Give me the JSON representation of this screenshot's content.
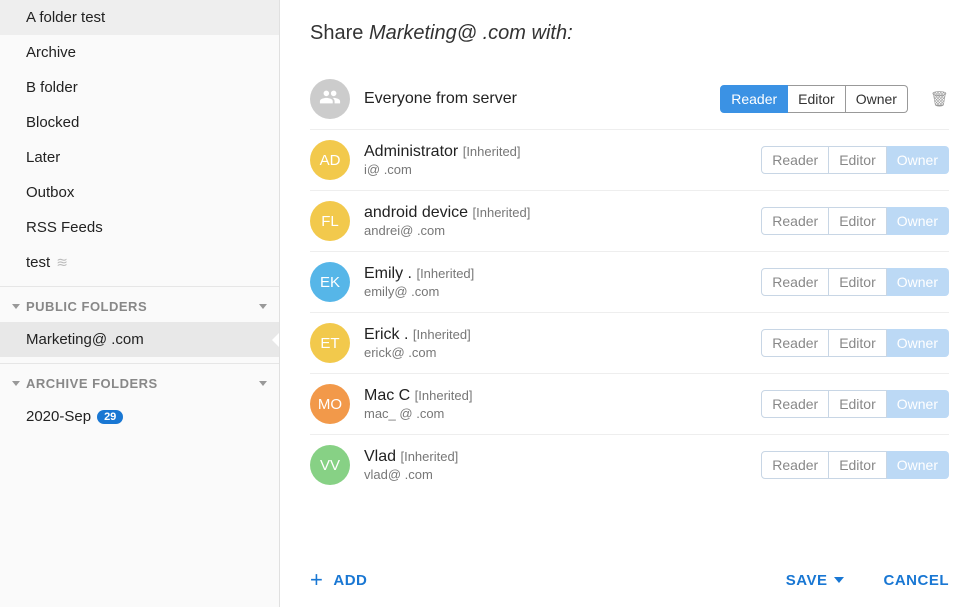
{
  "sidebar": {
    "topItems": [
      {
        "label": "A folder test"
      },
      {
        "label": "Archive"
      },
      {
        "label": "B folder"
      },
      {
        "label": "Blocked"
      },
      {
        "label": "Later"
      },
      {
        "label": "Outbox"
      },
      {
        "label": "RSS Feeds"
      },
      {
        "label": "test",
        "rss": true
      }
    ],
    "publicHeader": "PUBLIC FOLDERS",
    "publicItems": [
      {
        "label": "Marketing@            .com",
        "selected": true
      }
    ],
    "archiveHeader": "ARCHIVE FOLDERS",
    "archiveItems": [
      {
        "label": "2020-Sep",
        "badge": "29"
      }
    ]
  },
  "share": {
    "prefix": "Share ",
    "name": "Marketing@",
    "suffix": "            .com with:",
    "roles": {
      "reader": "Reader",
      "editor": "Editor",
      "owner": "Owner"
    },
    "rows": [
      {
        "avatar": "group",
        "avClass": "av-gray",
        "name": "Everyone from server",
        "email": "",
        "inherited": false,
        "active": "reader",
        "style": "solid",
        "deletable": true
      },
      {
        "avatar": "AD",
        "avClass": "av-yellow",
        "name": "Administrator",
        "email": "        i@             .com",
        "inherited": true,
        "active": "owner",
        "style": "light"
      },
      {
        "avatar": "FL",
        "avClass": "av-yellow",
        "name": "android device",
        "email": "andrei@              .com",
        "inherited": true,
        "active": "owner",
        "style": "light"
      },
      {
        "avatar": "EK",
        "avClass": "av-blue",
        "name": "Emily .",
        "email": "emily@               .com",
        "inherited": true,
        "active": "owner",
        "style": "light"
      },
      {
        "avatar": "ET",
        "avClass": "av-yellow",
        "name": "Erick .",
        "email": "erick@             .com",
        "inherited": true,
        "active": "owner",
        "style": "light"
      },
      {
        "avatar": "MO",
        "avClass": "av-orange",
        "name": "Mac C",
        "email": "mac_        @            .com",
        "inherited": true,
        "active": "owner",
        "style": "light"
      },
      {
        "avatar": "VV",
        "avClass": "av-green",
        "name": "Vlad",
        "email": "vlad@           .com",
        "inherited": true,
        "active": "owner",
        "style": "light"
      }
    ],
    "inheritedTag": "[Inherited]",
    "addLabel": "ADD",
    "saveLabel": "SAVE",
    "cancelLabel": "CANCEL"
  }
}
